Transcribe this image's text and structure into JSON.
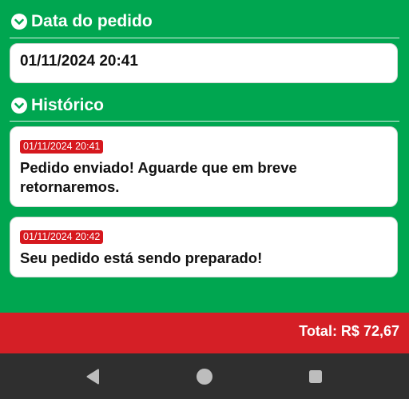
{
  "order_date": {
    "heading": "Data do pedido",
    "value": "01/11/2024 20:41"
  },
  "history": {
    "heading": "Histórico",
    "entries": [
      {
        "timestamp": "01/11/2024 20:41",
        "message": "Pedido enviado! Aguarde que em breve retornaremos."
      },
      {
        "timestamp": "01/11/2024 20:42",
        "message": "Seu pedido está sendo preparado!"
      }
    ]
  },
  "footer": {
    "total": "Total: R$ 72,67"
  },
  "nav": {
    "icons": [
      "back-icon",
      "home-icon",
      "recents-icon"
    ]
  },
  "colors": {
    "background": "#00a650",
    "badge": "#d6181e",
    "total_bar": "#d51f26",
    "nav_bar": "#2f2f2f"
  }
}
